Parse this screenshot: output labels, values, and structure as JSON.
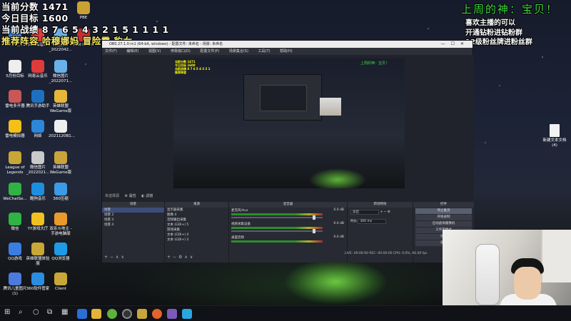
{
  "overlay": {
    "score": "当前分数 1471",
    "target": "今日目标 1600",
    "record": "当前战绩 8 7 6 5 4 3 2 1 5 1 1 1 1",
    "lineup": "推荐阵容 哈穆娜妈 冒险霞 豹女",
    "god": "上周的神：宝贝！",
    "promo": [
      "喜欢主播的可以",
      "开通钻粉进钻粉群",
      "12级粉丝牌进粉丝群"
    ]
  },
  "desktop_icons": [
    {
      "label": "PBE"
    },
    {
      "label": "360安全卫士"
    },
    {
      "label": "网易云音乐"
    },
    {
      "label": "微信图片_2022042..."
    },
    {
      "label": "Riot Client"
    },
    {
      "label": "5月份目标"
    },
    {
      "label": "网易云音乐"
    },
    {
      "label": "微信图片_2022071..."
    },
    {
      "label": "雷电多开器"
    },
    {
      "label": "腾讯手游助手"
    },
    {
      "label": "英雄联盟WeGame版"
    },
    {
      "label": "雷电模拟器"
    },
    {
      "label": "网络"
    },
    {
      "label": "2021120B1..."
    },
    {
      "label": "League of Legends"
    },
    {
      "label": "微信图片_2022021..."
    },
    {
      "label": "英雄联盟WeGame版"
    },
    {
      "label": "WeChatSe..."
    },
    {
      "label": "酷狗音乐"
    },
    {
      "label": "360压缩"
    },
    {
      "label": "微信"
    },
    {
      "label": "YY游戏大厅"
    },
    {
      "label": "双杀斗地主 - 手游电脑版"
    },
    {
      "label": "QQ游戏"
    },
    {
      "label": "英雄联盟体验服"
    },
    {
      "label": "QQ浏览器"
    },
    {
      "label": "腾讯儿童图片(1)"
    },
    {
      "label": "360软件管家"
    },
    {
      "label": "Client"
    },
    {
      "label": "新建文本文档(4)"
    }
  ],
  "obs": {
    "title": "OBS 27.1.0-rc1 (64-bit, windows) - 配置文件: 未命名 - 场景: 未命名",
    "menu": [
      "文件(F)",
      "编辑(E)",
      "视图(V)",
      "停靠窗口(D)",
      "配置文件(P)",
      "场景集合(S)",
      "工具(T)",
      "帮助(H)"
    ],
    "source_label": "未选择源",
    "properties_btn": "属性",
    "filters_btn": "滤镜",
    "scenes": {
      "title": "场景",
      "items": [
        "场景",
        "场景 2",
        "场景 3",
        "场景 4"
      ]
    },
    "sources": {
      "title": "来源",
      "items": [
        "显示器采集",
        "图像 4",
        "音频输出采集",
        "文本 (GDI+) 5",
        "游戏采集",
        "文本 (GDI+) 4",
        "文本 (GDI+) 3"
      ]
    },
    "mixer": {
      "title": "混音器",
      "rows": [
        {
          "name": "麦克风/Aux",
          "db": "0.0 dB"
        },
        {
          "name": "视频采集设备",
          "db": "0.0 dB"
        },
        {
          "name": "桌面音频",
          "db": "0.0 dB"
        }
      ]
    },
    "transitions": {
      "title": "转场特效",
      "type": "淡出",
      "duration_label": "时长",
      "duration": "300 ms"
    },
    "controls": {
      "title": "控件",
      "buttons": [
        "停止推流",
        "开始录制",
        "启动虚拟摄像机",
        "工作室模式",
        "设置",
        "退出"
      ]
    },
    "status": "LIVE: 00:00:00  REC: 00:00:00  CPU: 0.0%, 60.00 fps"
  },
  "colors": {
    "overlay_green": "#3fdc3f",
    "overlay_yellow": "#f5e96a",
    "obs_bg": "#272a33"
  }
}
